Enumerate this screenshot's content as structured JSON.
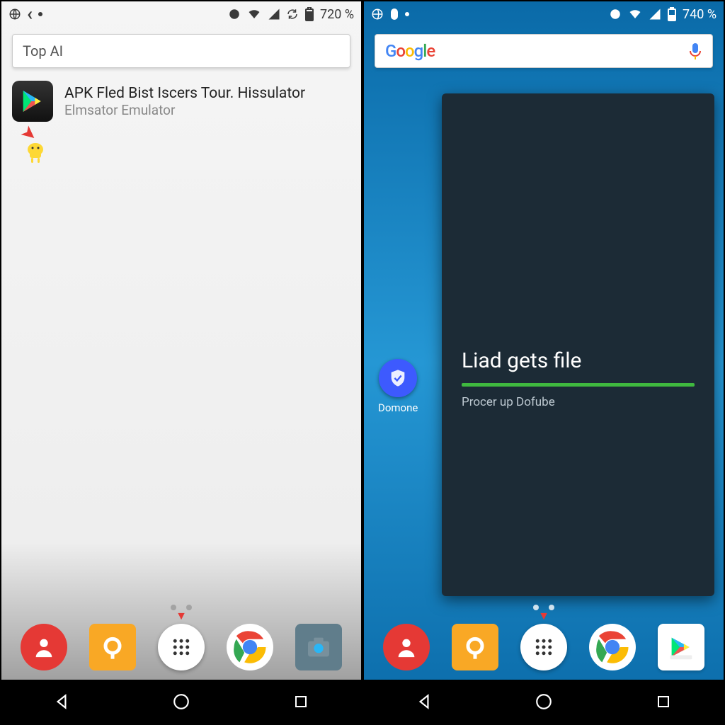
{
  "left": {
    "status": {
      "battery_text": "720 %"
    },
    "search": {
      "placeholder": "Top AI"
    },
    "result": {
      "title": "APK Fled Bist Iscers Tour. Hissulator",
      "subtitle": "Elmsator Emulator"
    }
  },
  "right": {
    "status": {
      "battery_text": "740 %"
    },
    "search": {
      "brand": "Google"
    },
    "side_app": {
      "label": "Domone"
    },
    "panel": {
      "title": "Liad gets file",
      "subtitle": "Procer up Dofube"
    }
  },
  "dock": {
    "items": [
      "contacts",
      "loop",
      "drawer",
      "chrome",
      "camera"
    ],
    "items_right": [
      "contacts",
      "loop",
      "drawer",
      "chrome",
      "play"
    ]
  }
}
